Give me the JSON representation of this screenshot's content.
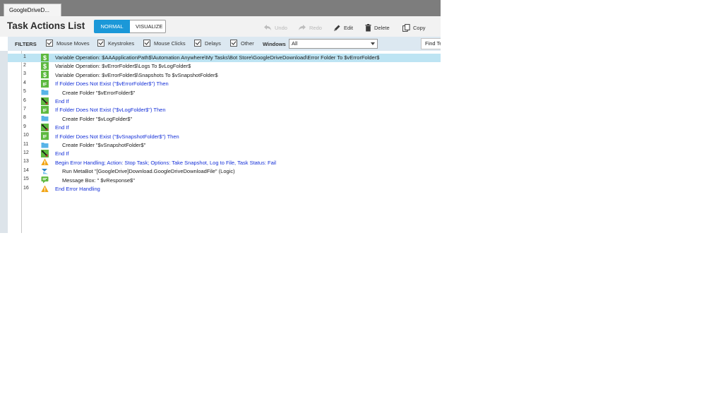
{
  "document_tab": {
    "title": "GoogleDriveD..."
  },
  "header": {
    "title": "Task Actions List",
    "modes": {
      "normal": "NORMAL",
      "visualize": "VISUALIZE"
    },
    "toolbar": {
      "undo": "Undo",
      "redo": "Redo",
      "edit": "Edit",
      "delete": "Delete",
      "copy": "Copy"
    }
  },
  "filters": {
    "label": "FILTERS",
    "items": [
      {
        "label": "Mouse Moves",
        "checked": true
      },
      {
        "label": "Keystrokes",
        "checked": true
      },
      {
        "label": "Mouse Clicks",
        "checked": true
      },
      {
        "label": "Delays",
        "checked": true
      },
      {
        "label": "Other",
        "checked": true
      }
    ],
    "windows_label": "Windows",
    "windows_value": "All",
    "find_placeholder": "Find Te"
  },
  "colors": {
    "accent": "#1b98d8",
    "selected_row": "#bde4f3",
    "control_flow_text": "#1530d8",
    "filters_bar": "#dce8f1"
  },
  "actions": [
    {
      "num": "1",
      "icon": "variable-icon",
      "text": "Variable Operation: $AAApplicationPath$\\Automation Anywhere\\My Tasks\\Bot Store\\GoogleDriveDownload\\Error Folder To $vErrorFolder$",
      "style": "plain",
      "indent": 0,
      "selected": true
    },
    {
      "num": "2",
      "icon": "variable-icon",
      "text": "Variable Operation: $vErrorFolder$\\Logs To $vLogFolder$",
      "style": "plain",
      "indent": 0,
      "selected": false
    },
    {
      "num": "3",
      "icon": "variable-icon",
      "text": "Variable Operation: $vErrorFolder$\\Snapshots To $vSnapshotFolder$",
      "style": "plain",
      "indent": 0,
      "selected": false
    },
    {
      "num": "4",
      "icon": "if-icon",
      "text": "If Folder Does Not Exist (\"$vErrorFolder$\")  Then",
      "style": "blue",
      "indent": 0,
      "selected": false
    },
    {
      "num": "5",
      "icon": "folder-icon",
      "text": "Create Folder \"$vErrorFolder$\"",
      "style": "plain",
      "indent": 1,
      "selected": false
    },
    {
      "num": "6",
      "icon": "end-if-icon",
      "text": "End If",
      "style": "blue",
      "indent": 0,
      "selected": false
    },
    {
      "num": "7",
      "icon": "if-icon",
      "text": "If Folder Does Not Exist (\"$vLogFolder$\")  Then",
      "style": "blue",
      "indent": 0,
      "selected": false
    },
    {
      "num": "8",
      "icon": "folder-icon",
      "text": "Create Folder \"$vLogFolder$\"",
      "style": "plain",
      "indent": 1,
      "selected": false
    },
    {
      "num": "9",
      "icon": "end-if-icon",
      "text": "End If",
      "style": "blue",
      "indent": 0,
      "selected": false
    },
    {
      "num": "10",
      "icon": "if-icon",
      "text": "If Folder Does Not Exist (\"$vSnapshotFolder$\")  Then",
      "style": "blue",
      "indent": 0,
      "selected": false
    },
    {
      "num": "11",
      "icon": "folder-icon",
      "text": "Create Folder \"$vSnapshotFolder$\"",
      "style": "plain",
      "indent": 1,
      "selected": false
    },
    {
      "num": "12",
      "icon": "end-if-icon",
      "text": "End If",
      "style": "blue",
      "indent": 0,
      "selected": false
    },
    {
      "num": "13",
      "icon": "warning-icon",
      "text": "Begin Error Handling; Action: Stop Task; Options: Take Snapshot, Log to File,  Task Status: Fail",
      "style": "blue",
      "indent": 0,
      "selected": false
    },
    {
      "num": "14",
      "icon": "metabot-icon",
      "text": "Run MetaBot \"[GoogleDrive]Download.GoogleDriveDownloadFile\" (Logic)",
      "style": "plain",
      "indent": 1,
      "selected": false
    },
    {
      "num": "15",
      "icon": "message-box-icon",
      "text": "Message Box: \" $vResponse$\"",
      "style": "plain",
      "indent": 1,
      "selected": false
    },
    {
      "num": "16",
      "icon": "warning-icon",
      "text": "End Error Handling",
      "style": "blue",
      "indent": 0,
      "selected": false
    }
  ]
}
